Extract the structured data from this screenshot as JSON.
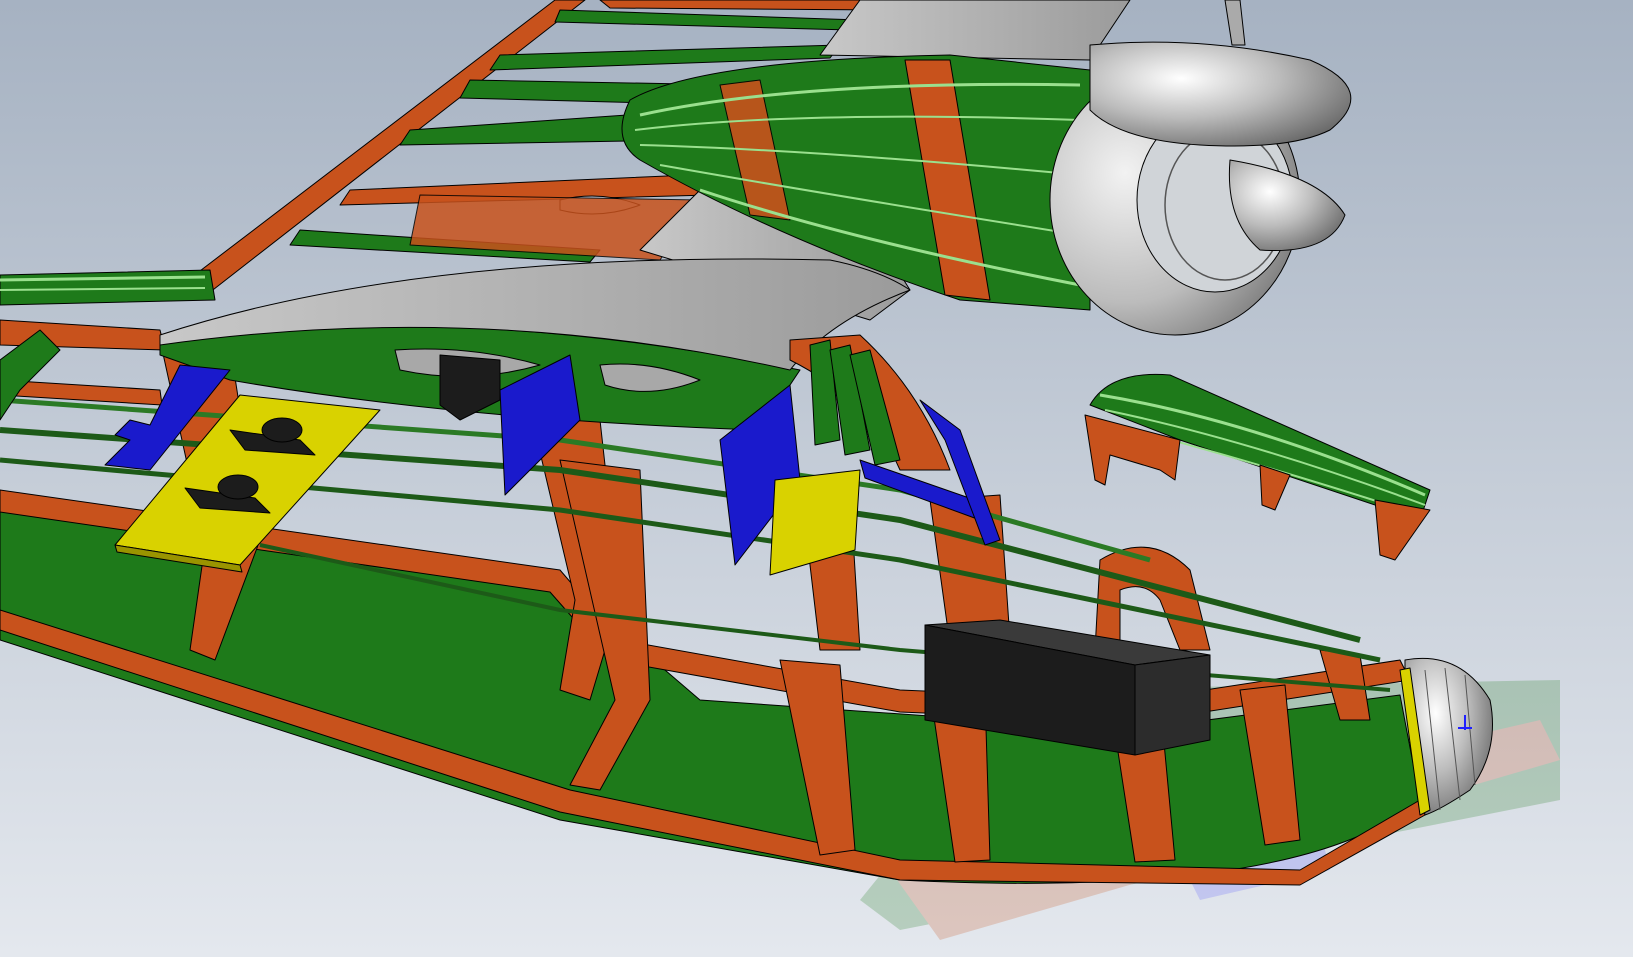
{
  "window": {},
  "scene": {
    "subject": "aircraft-fuselage-nose-wing-nacelle-cad-assembly",
    "view": "isometric-shaded-with-edges",
    "floor_reflection": true,
    "colors": {
      "background_top": "#a6b2c2",
      "background_bottom": "#e4e8ee",
      "ply_frame_orange": "#c8521c",
      "ply_frame_orange_dark": "#8a3510",
      "green_sheeting": "#1e7a1a",
      "green_sheeting_light": "#3c9a36",
      "green_stringer_highlight": "#9ae08e",
      "grey_skin": "#9b9b9b",
      "grey_skin_light": "#c8c8c8",
      "spinner_chrome": "#bcbcbc",
      "servo_tray_yellow": "#d9d200",
      "bracket_blue": "#1a1acc",
      "component_black": "#1c1c1c",
      "edge_line": "#000000"
    },
    "components": [
      "fuselage-side-frames",
      "fuselage-formers",
      "fuselage-stringers",
      "wing-ribs",
      "wing-leading-edge-sheeting",
      "wing-center-section-skin",
      "engine-nacelle-frames",
      "engine-cowl-ring",
      "propeller-spinner",
      "canopy-frame-exploded",
      "servo-tray",
      "servo",
      "wing-mount-brackets",
      "battery-pack",
      "nose-cap"
    ]
  }
}
